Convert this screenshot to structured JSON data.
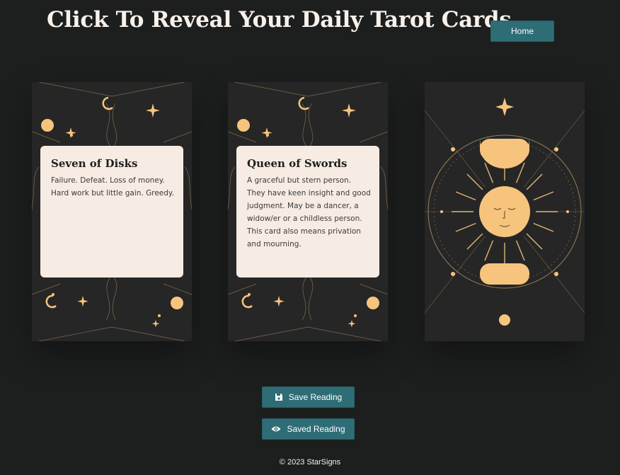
{
  "header": {
    "title": "Click To Reveal Your Daily Tarot Cards",
    "home_label": "Home"
  },
  "cards": [
    {
      "name": "Seven of Disks",
      "meaning": "Failure. Defeat. Loss of money. Hard work but little gain. Greedy.",
      "revealed": true
    },
    {
      "name": "Queen of Swords",
      "meaning": "A graceful but stern person. They have keen insight and good judgment. May be a dancer, a widow/er or a childless person. This card also means privation and mourning.",
      "revealed": true
    },
    {
      "revealed": false,
      "back_design": "sun-and-moon-phases"
    }
  ],
  "actions": {
    "save_label": "Save Reading",
    "save_icon": "floppy-disk-icon",
    "saved_label": "Saved Reading",
    "saved_icon": "eye-icon"
  },
  "footer": {
    "copyright": "© 2023 StarSigns"
  },
  "colors": {
    "background": "#1d1f1f",
    "button": "#2e6d76",
    "card_gold": "#f7c47e",
    "panel": "#f6ece3"
  }
}
